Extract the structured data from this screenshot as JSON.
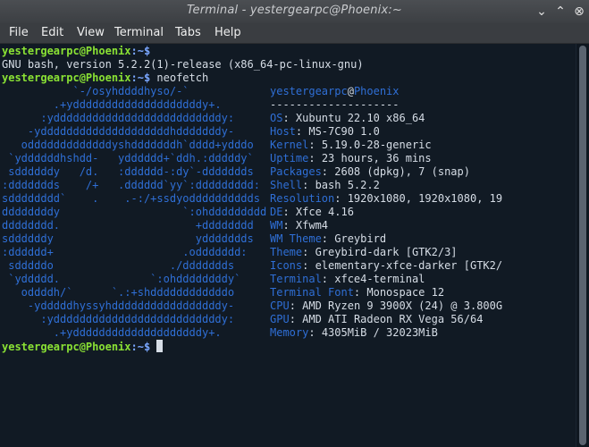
{
  "window": {
    "title": "Terminal - yestergearpc@Phoenix:~"
  },
  "window_controls": {
    "minimize": "⌄",
    "maximize": "⌃",
    "close": "⊗"
  },
  "menu": [
    "File",
    "Edit",
    "View",
    "Terminal",
    "Tabs",
    "Help"
  ],
  "terminal": {
    "prompt_user": "yestergearpc@Phoenix",
    "prompt_suffix": ":~$",
    "lines": [
      {
        "type": "prompt",
        "cmd": ""
      },
      {
        "type": "text",
        "text": "GNU bash, version 5.2.2(1)-release (x86_64-pc-linux-gnu)"
      },
      {
        "type": "prompt",
        "cmd": " neofetch"
      }
    ],
    "neofetch_logo": [
      "           `-/osyhddddhyso/-`",
      "        .+yddddddddddddddddddddy+.",
      "      :yddddddddddddddddddddddddddy:",
      "    -yddddddddddddddddddddhdddddddy-",
      "   odddddddddddddyshdddddddh`dddd+ydddo",
      " `yddddddhshdd-   ydddddd+`ddh.:dddddy`",
      " sddddddy   /d.   :dddddd-:dy`-ddddddds",
      ":ddddddds    /+   .dddddd`yy`:ddddddddd:",
      "sdddddddd`    .    .-:/+ssdyodddddddddds",
      "ddddddddy                   `:ohddddddddd",
      "dddddddd.                     +dddddddd",
      "sddddddy                      yddddddds",
      ":dddddd+                    .oddddddd:",
      " sdddddo                  ./ddddddds",
      " `yddddd.              `:ohddddddddy`",
      "   oddddh/`      `.:+shddddddddddddo",
      "    -ydddddhyssyhdddddddddddddddddy-",
      "      :yddddddddddddddddddddddddddy:",
      "        .+yddddddddddddddddddddy+."
    ],
    "neofetch_header": {
      "user": "yestergearpc",
      "at": "@",
      "host": "Phoenix",
      "sep": "--------------------"
    },
    "neofetch_info": [
      {
        "key": "OS",
        "value": "Xubuntu 22.10 x86_64"
      },
      {
        "key": "Host",
        "value": "MS-7C90 1.0"
      },
      {
        "key": "Kernel",
        "value": "5.19.0-28-generic"
      },
      {
        "key": "Uptime",
        "value": "23 hours, 36 mins"
      },
      {
        "key": "Packages",
        "value": "2608 (dpkg), 7 (snap)"
      },
      {
        "key": "Shell",
        "value": "bash 5.2.2"
      },
      {
        "key": "Resolution",
        "value": "1920x1080, 1920x1080, 19"
      },
      {
        "key": "DE",
        "value": "Xfce 4.16"
      },
      {
        "key": "WM",
        "value": "Xfwm4"
      },
      {
        "key": "WM Theme",
        "value": "Greybird"
      },
      {
        "key": "Theme",
        "value": "Greybird-dark [GTK2/3]"
      },
      {
        "key": "Icons",
        "value": "elementary-xfce-darker [GTK2/"
      },
      {
        "key": "Terminal",
        "value": "xfce4-terminal"
      },
      {
        "key": "Terminal Font",
        "value": "Monospace 12"
      },
      {
        "key": "CPU",
        "value": "AMD Ryzen 9 3900X (24) @ 3.800G"
      },
      {
        "key": "GPU",
        "value": "AMD ATI Radeon RX Vega 56/64"
      },
      {
        "key": "Memory",
        "value": "4305MiB / 32023MiB"
      }
    ],
    "final_prompt_cmd": " "
  },
  "colors": {
    "bg": "#111a24",
    "user": "#8ae234",
    "logo": "#2f6fd6",
    "text": "#d6dde6"
  }
}
